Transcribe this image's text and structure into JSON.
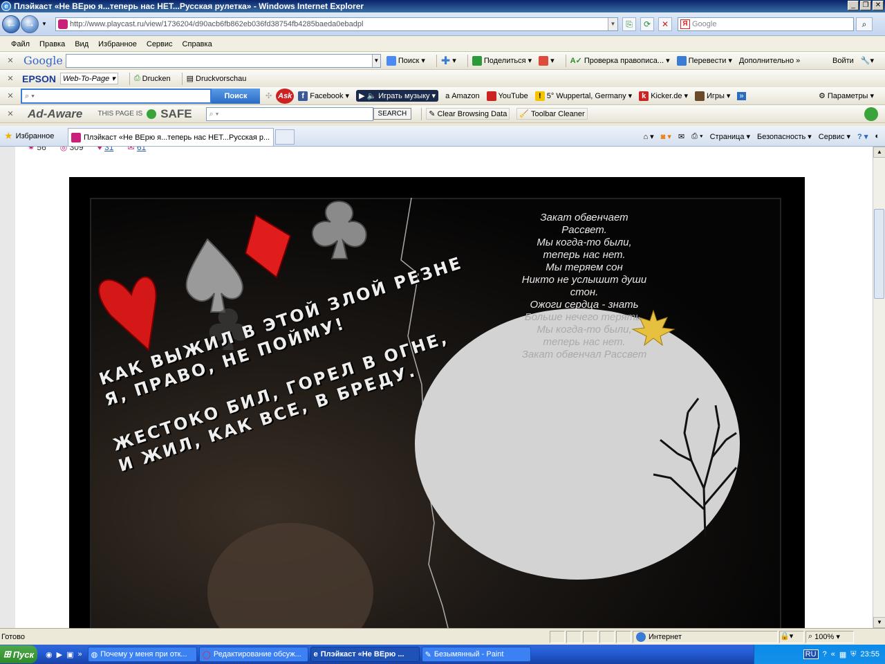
{
  "window": {
    "title": "Плэйкаст «Не ВЕрю я...теперь нас НЕТ...Русская рулетка» - Windows Internet Explorer",
    "ie_glyph": "e"
  },
  "address_bar": {
    "url": "http://www.playcast.ru/view/1736204/d90acb6fb862eb036fd38754fb4285baeda0ebadpl",
    "search_placeholder": "Google",
    "yandex_glyph": "Я"
  },
  "menu": [
    "Файл",
    "Правка",
    "Вид",
    "Избранное",
    "Сервис",
    "Справка"
  ],
  "google_toolbar": {
    "logo": "Google",
    "search": "Поиск",
    "share": "Поделиться",
    "spell": "Проверка правописа...",
    "translate": "Перевести",
    "more": "Дополнительно »",
    "signin": "Войти"
  },
  "epson_toolbar": {
    "logo": "EPSON",
    "web_to_page": "Web-To-Page",
    "print": "Drucken",
    "preview": "Druckvorschau"
  },
  "ask_toolbar": {
    "search_button": "Поиск",
    "ask_logo": "Ask",
    "facebook": "Facebook",
    "play_music": "Играть музыку",
    "amazon": "Amazon",
    "youtube": "YouTube",
    "weather": "5° Wuppertal, Germany",
    "kicker": "Kicker.de",
    "games": "Игры",
    "params": "Параметры"
  },
  "adaware_toolbar": {
    "logo": "Ad-Aware",
    "page_is": "THIS PAGE IS",
    "safe": "SAFE",
    "search_button": "SEARCH",
    "clear": "Clear Browsing Data",
    "cleaner": "Toolbar Cleaner"
  },
  "tabs": {
    "favorites": "Избранное",
    "active_tab": "Плэйкаст «Не ВЕрю я...теперь нас НЕТ...Русская р...",
    "commands": [
      "Страница",
      "Безопасность",
      "Сервис"
    ]
  },
  "page": {
    "stats": [
      "56",
      "309",
      "31",
      "61"
    ],
    "poem": [
      "Закат обвенчает",
      "Рассвет.",
      "Мы когда-то были,",
      "теперь нас нет.",
      "Мы теряем сон",
      "Никто не услышит души",
      "стон.",
      "Ожоги сердца - знать",
      "Больше нечего терять.",
      "Мы когда-то были,",
      "теперь нас нет.",
      "Закат обвенчал Рассвет"
    ],
    "overlay_lines": [
      "КАК ВЫЖИЛ В ЭТОЙ ЗЛОЙ РЕЗНЕ",
      "Я, ПРАВО, НЕ ПОЙМУ!",
      "ЖЕСТОКО БИЛ, ГОРЕЛ В ОГНЕ,",
      "И ЖИЛ, КАК ВСЕ, В БРЕДУ."
    ]
  },
  "status_bar": {
    "text": "Готово",
    "zone": "Интернет",
    "zoom": "100%"
  },
  "taskbar": {
    "start": "Пуск",
    "tasks": [
      "Почему у меня при отк...",
      "Редактирование обсуж...",
      "Плэйкаст «Не ВЕрю ...",
      "Безымянный - Paint"
    ],
    "lang": "RU",
    "clock": "23:55"
  },
  "colors": {
    "title_bar": "#0a246a",
    "taskbar": "#245dd7",
    "moon": "#d3d3d3",
    "heart": "#d41818"
  }
}
